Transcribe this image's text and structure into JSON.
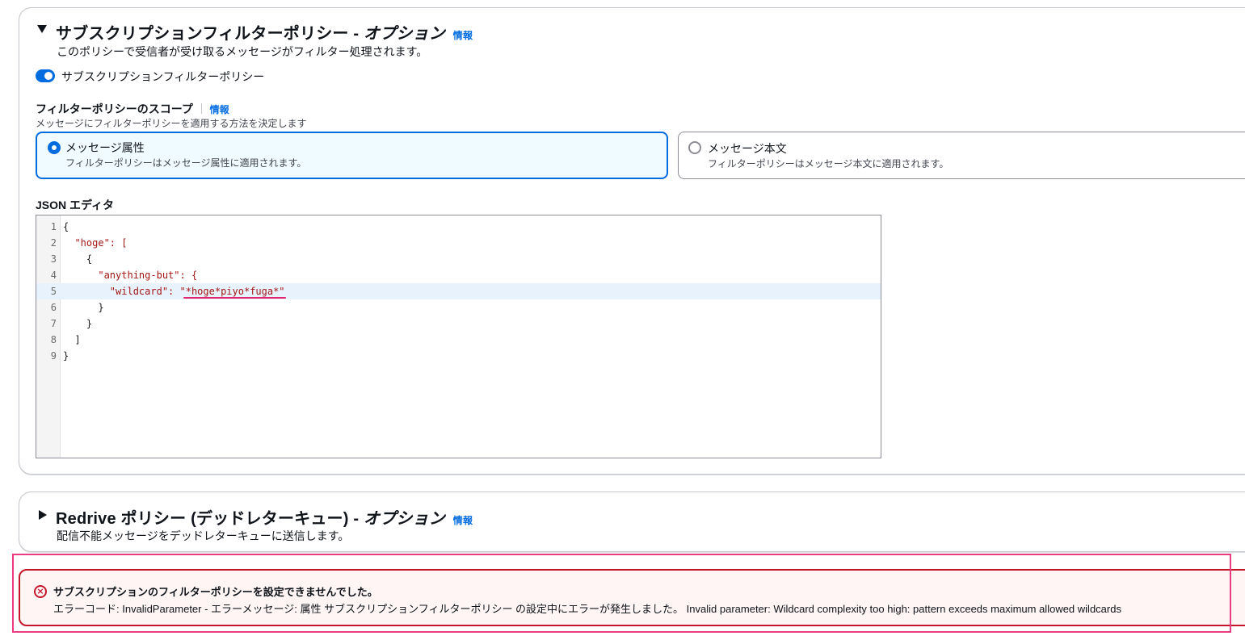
{
  "filter_section": {
    "title": "サブスクリプションフィルターポリシー - ",
    "title_optional": "オプション",
    "info": "情報",
    "description": "このポリシーで受信者が受け取るメッセージがフィルター処理されます。",
    "toggle_label": "サブスクリプションフィルターポリシー",
    "toggle_on": true,
    "scope": {
      "label": "フィルターポリシーのスコープ",
      "info": "情報",
      "description": "メッセージにフィルターポリシーを適用する方法を決定します",
      "options": [
        {
          "title": "メッセージ属性",
          "description": "フィルターポリシーはメッセージ属性に適用されます。",
          "selected": true
        },
        {
          "title": "メッセージ本文",
          "description": "フィルターポリシーはメッセージ本文に適用されます。",
          "selected": false
        }
      ]
    },
    "editor": {
      "label": "JSON エディタ",
      "lines": [
        {
          "num": "1",
          "text": "{"
        },
        {
          "num": "2",
          "text": "  \"hoge\": ["
        },
        {
          "num": "3",
          "text": "    {"
        },
        {
          "num": "4",
          "text": "      \"anything-but\": {"
        },
        {
          "num": "5",
          "text": "        \"wildcard\": \"*hoge*piyo*fuga*\""
        },
        {
          "num": "6",
          "text": "      }"
        },
        {
          "num": "7",
          "text": "    }"
        },
        {
          "num": "8",
          "text": "  ]"
        },
        {
          "num": "9",
          "text": "}"
        }
      ],
      "active_line": 5,
      "colors": {
        "string": "#a31515",
        "error_underline": "#e0246f"
      }
    }
  },
  "redrive_section": {
    "title": "Redrive ポリシー (デッドレターキュー) - ",
    "title_optional": "オプション",
    "info": "情報",
    "description": "配信不能メッセージをデッドレターキューに送信します。"
  },
  "error_alert": {
    "icon": "error-circle-icon",
    "title": "サブスクリプションのフィルターポリシーを設定できませんでした。",
    "message": "エラーコード: InvalidParameter - エラーメッセージ: 属性 サブスクリプションフィルターポリシー の設定中にエラーが発生しました。 Invalid parameter: Wildcard complexity too high: pattern exceeds maximum allowed wildcards",
    "colors": {
      "border": "#c5152b",
      "background": "#fff5f5",
      "highlight": "#ea3d81"
    }
  }
}
